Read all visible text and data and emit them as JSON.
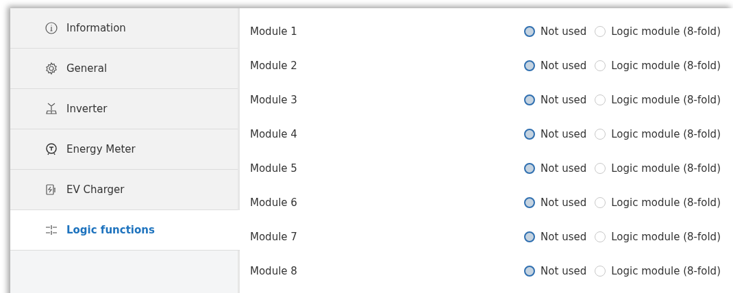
{
  "sidebar": {
    "items": [
      {
        "label": "Information",
        "selected": false
      },
      {
        "label": "General",
        "selected": false
      },
      {
        "label": "Inverter",
        "selected": false
      },
      {
        "label": "Energy Meter",
        "selected": false
      },
      {
        "label": "EV Charger",
        "selected": false
      },
      {
        "label": "Logic functions",
        "selected": true
      }
    ]
  },
  "modules": [
    {
      "label": "Module 1",
      "options": [
        {
          "label": "Not used",
          "selected": true
        },
        {
          "label": "Logic module (8-fold)",
          "selected": false
        }
      ]
    },
    {
      "label": "Module 2",
      "options": [
        {
          "label": "Not used",
          "selected": true
        },
        {
          "label": "Logic module (8-fold)",
          "selected": false
        }
      ]
    },
    {
      "label": "Module 3",
      "options": [
        {
          "label": "Not used",
          "selected": true
        },
        {
          "label": "Logic module (8-fold)",
          "selected": false
        }
      ]
    },
    {
      "label": "Module 4",
      "options": [
        {
          "label": "Not used",
          "selected": true
        },
        {
          "label": "Logic module (8-fold)",
          "selected": false
        }
      ]
    },
    {
      "label": "Module 5",
      "options": [
        {
          "label": "Not used",
          "selected": true
        },
        {
          "label": "Logic module (8-fold)",
          "selected": false
        }
      ]
    },
    {
      "label": "Module 6",
      "options": [
        {
          "label": "Not used",
          "selected": true
        },
        {
          "label": "Logic module (8-fold)",
          "selected": false
        }
      ]
    },
    {
      "label": "Module 7",
      "options": [
        {
          "label": "Not used",
          "selected": true
        },
        {
          "label": "Logic module (8-fold)",
          "selected": false
        }
      ]
    },
    {
      "label": "Module 8",
      "options": [
        {
          "label": "Not used",
          "selected": true
        },
        {
          "label": "Logic module (8-fold)",
          "selected": false
        }
      ]
    }
  ]
}
